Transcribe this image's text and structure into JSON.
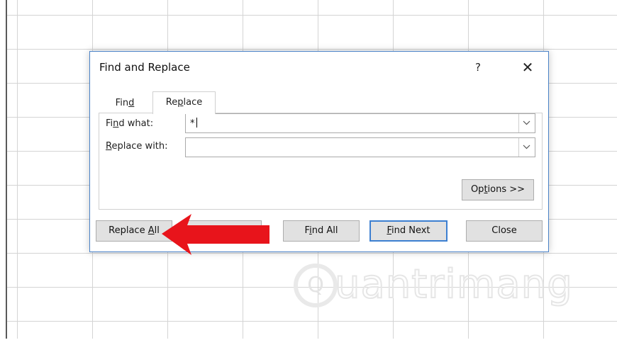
{
  "dialog": {
    "title": "Find and Replace",
    "help_label": "?",
    "close_label": "✕"
  },
  "tabs": [
    {
      "pre": "Fin",
      "key": "d",
      "post": "",
      "active": false
    },
    {
      "pre": "Re",
      "key": "p",
      "post": "lace",
      "active": true
    }
  ],
  "fields": {
    "find_label": {
      "pre": "Fi",
      "key": "n",
      "post": "d what:"
    },
    "find_value": "*",
    "replace_label": {
      "pre": "",
      "key": "R",
      "post": "eplace with:"
    },
    "replace_value": ""
  },
  "buttons": {
    "options": {
      "pre": "Op",
      "key": "t",
      "post": "ions >>"
    },
    "replace_all": {
      "pre": "Replace ",
      "key": "A",
      "post": "ll"
    },
    "find_all": {
      "pre": "F",
      "key": "i",
      "post": "nd All"
    },
    "find_next": {
      "pre": "",
      "key": "F",
      "post": "ind Next"
    },
    "close": "Close"
  },
  "watermark": {
    "text": "uantrimang",
    "logo_glyph": "Q"
  },
  "colors": {
    "arrow": "#e8141b",
    "accent": "#3c7fd1"
  }
}
